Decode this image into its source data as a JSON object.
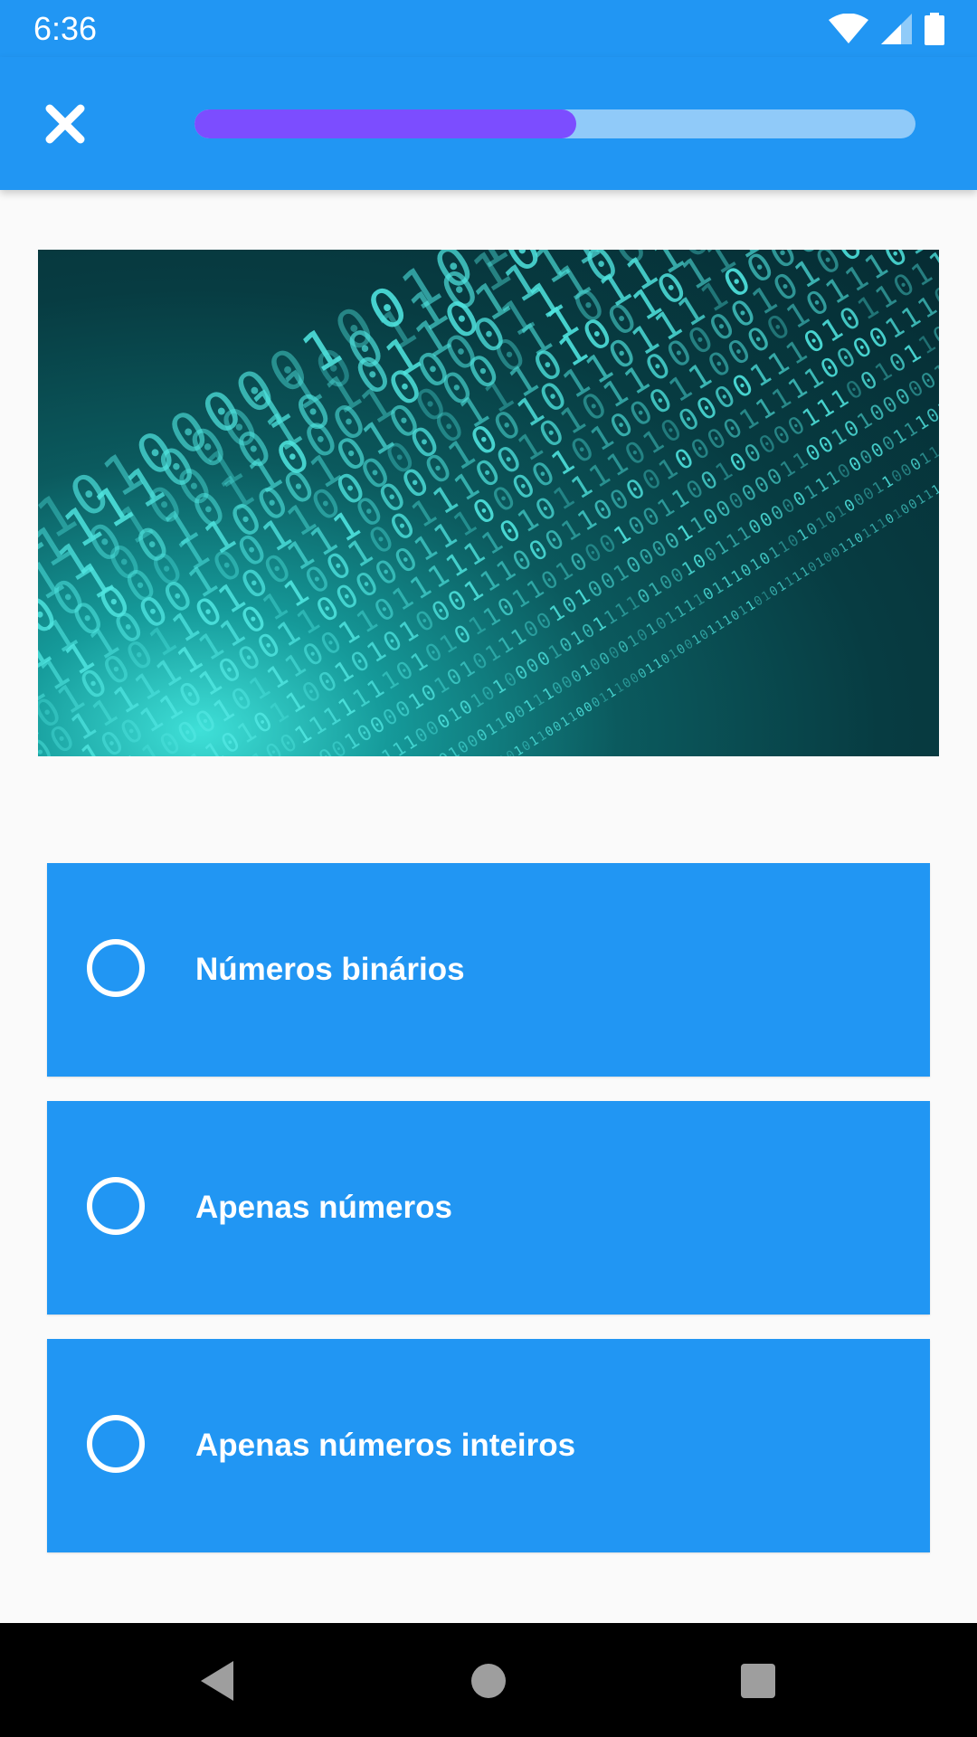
{
  "status_bar": {
    "time": "6:36",
    "icons": [
      "wifi-icon",
      "signal-icon",
      "battery-icon"
    ]
  },
  "app_bar": {
    "close_icon": "close-icon",
    "progress": 0.53,
    "colors": {
      "bar": "#2196f3",
      "progress_fill": "#7c4dff",
      "progress_track": "#90caf9"
    }
  },
  "question_image": {
    "description": "binary-digits-image"
  },
  "options": [
    {
      "label": "Números binários"
    },
    {
      "label": "Apenas números"
    },
    {
      "label": "Apenas números inteiros"
    }
  ],
  "nav_bar": {
    "icons": [
      "back-icon",
      "home-icon",
      "recents-icon"
    ]
  }
}
